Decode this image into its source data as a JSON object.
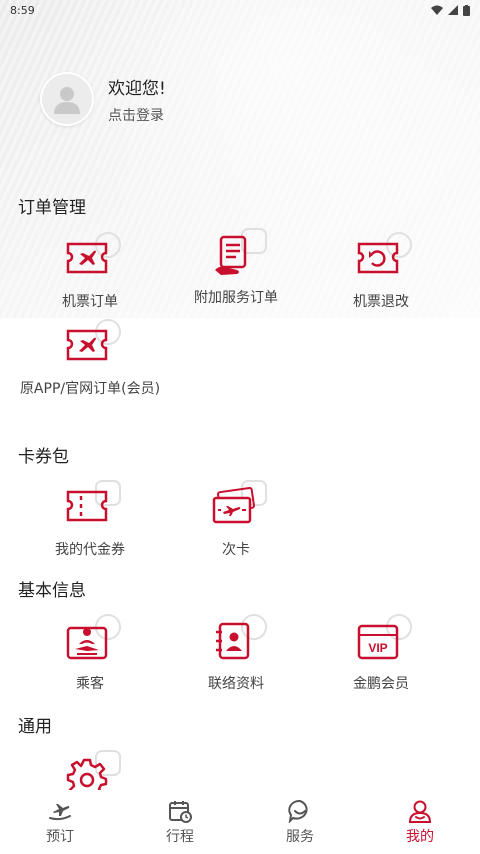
{
  "status_bar": {
    "time": "8:59"
  },
  "profile": {
    "welcome": "欢迎您!",
    "login": "点击登录"
  },
  "sections": {
    "orders": {
      "title": "订单管理",
      "items": [
        {
          "label": "机票订单",
          "icon": "plane-ticket-icon"
        },
        {
          "label": "附加服务订单",
          "icon": "service-list-icon"
        },
        {
          "label": "机票退改",
          "icon": "refund-ticket-icon"
        },
        {
          "label": "原APP/官网订单(会员)",
          "icon": "plane-ticket-icon"
        }
      ]
    },
    "wallet": {
      "title": "卡券包",
      "items": [
        {
          "label": "我的代金券",
          "icon": "voucher-icon"
        },
        {
          "label": "次卡",
          "icon": "pass-card-icon"
        }
      ]
    },
    "basic": {
      "title": "基本信息",
      "items": [
        {
          "label": "乘客",
          "icon": "passenger-icon"
        },
        {
          "label": "联络资料",
          "icon": "contact-book-icon"
        },
        {
          "label": "金鹏会员",
          "icon": "vip-icon"
        }
      ]
    },
    "general": {
      "title": "通用",
      "items": [
        {
          "label": "",
          "icon": "settings-gear-icon"
        }
      ]
    }
  },
  "tabs": [
    {
      "label": "预订",
      "icon": "booking-icon",
      "active": false
    },
    {
      "label": "行程",
      "icon": "itinerary-calendar-icon",
      "active": false
    },
    {
      "label": "服务",
      "icon": "service-chat-icon",
      "active": false
    },
    {
      "label": "我的",
      "icon": "profile-icon",
      "active": true
    }
  ],
  "colors": {
    "accent": "#c8102e",
    "text": "#333333"
  }
}
